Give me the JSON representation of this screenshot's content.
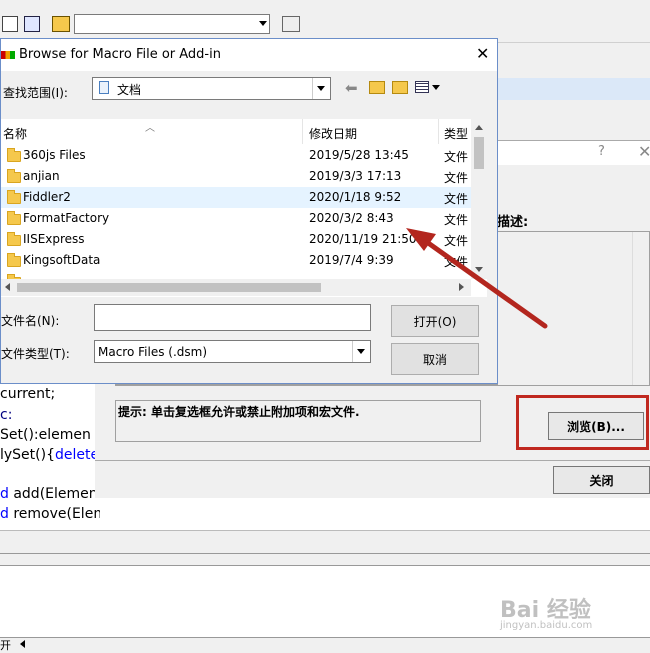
{
  "background_app": {
    "code_lines": [
      {
        "prefix": "",
        "text": "current;",
        "kw": ""
      },
      {
        "prefix": "",
        "text": "c:",
        "kw": ""
      },
      {
        "prefix": "",
        "text": "Set():elemen",
        "kw": ""
      },
      {
        "prefix": "",
        "text": "lySet(){",
        "kw": "delete"
      },
      {
        "prefix": "d",
        "text": " add(Element ele);",
        "kw": ""
      },
      {
        "prefix": "d",
        "text": " remove(Element ele);",
        "kw": ""
      }
    ],
    "bottom_tab_label": "开"
  },
  "addin_dialog": {
    "help_symbol": "?",
    "description_label": "描述:",
    "hint_text": "提示: 单击复选框允许或禁止附加项和宏文件.",
    "browse_button": "浏览(B)...",
    "close_button": "关闭",
    "highlight_color": "#c0281f"
  },
  "browse_dialog": {
    "title": "Browse for Macro File or Add-in",
    "lookin_label": "查找范围(I):",
    "lookin_value": "文档",
    "columns": {
      "name": "名称",
      "date": "修改日期",
      "type": "类型"
    },
    "files": [
      {
        "name": "360js Files",
        "date": "2019/5/28 13:45",
        "type": "文件"
      },
      {
        "name": "anjian",
        "date": "2019/3/3 17:13",
        "type": "文件"
      },
      {
        "name": "Fiddler2",
        "date": "2020/1/18 9:52",
        "type": "文件"
      },
      {
        "name": "FormatFactory",
        "date": "2020/3/2 8:43",
        "type": "文件"
      },
      {
        "name": "IISExpress",
        "date": "2020/11/19 21:50",
        "type": "文件"
      },
      {
        "name": "KingsoftData",
        "date": "2019/7/4 9:39",
        "type": "文件"
      }
    ],
    "filename_label": "文件名(N):",
    "filename_value": "",
    "filetype_label": "文件类型(T):",
    "filetype_value": "Macro Files (.dsm)",
    "open_button": "打开(O)",
    "cancel_button": "取消"
  },
  "watermark": {
    "brand": "Bai 经验",
    "url": "jingyan.baidu.com"
  }
}
